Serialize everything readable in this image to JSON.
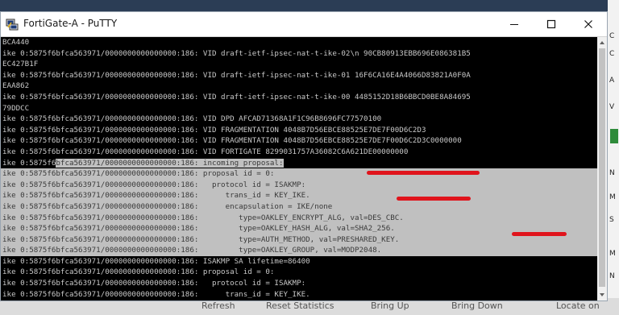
{
  "window": {
    "title": "FortiGate-A - PuTTY"
  },
  "terminal": {
    "lines": [
      "BCA440",
      "ike 0:5875f6bfca563971/0000000000000000:186: VID draft-ietf-ipsec-nat-t-ike-02\\n 90CB80913EBB696E086381B5",
      "EC427B1F",
      "ike 0:5875f6bfca563971/0000000000000000:186: VID draft-ietf-ipsec-nat-t-ike-01 16F6CA16E4A4066D83821A0F0A",
      "EAA862",
      "ike 0:5875f6bfca563971/0000000000000000:186: VID draft-ietf-ipsec-nat-t-ike-00 4485152D18B6BBCD0BE8A84695",
      "79DDCC",
      "ike 0:5875f6bfca563971/0000000000000000:186: VID DPD AFCAD71368A1F1C96B8696FC77570100",
      "ike 0:5875f6bfca563971/0000000000000000:186: VID FRAGMENTATION 4048B7D56EBCE88525E7DE7F00D6C2D3",
      "ike 0:5875f6bfca563971/0000000000000000:186: VID FRAGMENTATION 4048B7D56EBCE88525E7DE7F00D6C2D3C0000000",
      "ike 0:5875f6bfca563971/0000000000000000:186: VID FORTIGATE 8299031757A36082C6A621DE00000000",
      "ike 0:5875f6bfca563971/0000000000000000:186: incoming proposal:",
      "ike 0:5875f6bfca563971/0000000000000000:186: proposal id = 0:",
      "ike 0:5875f6bfca563971/0000000000000000:186:   protocol id = ISAKMP:",
      "ike 0:5875f6bfca563971/0000000000000000:186:      trans_id = KEY_IKE.",
      "ike 0:5875f6bfca563971/0000000000000000:186:      encapsulation = IKE/none",
      "ike 0:5875f6bfca563971/0000000000000000:186:         type=OAKLEY_ENCRYPT_ALG, val=DES_CBC.",
      "ike 0:5875f6bfca563971/0000000000000000:186:         type=OAKLEY_HASH_ALG, val=SHA2_256.",
      "ike 0:5875f6bfca563971/0000000000000000:186:         type=AUTH_METHOD, val=PRESHARED_KEY.",
      "ike 0:5875f6bfca563971/0000000000000000:186:         type=OAKLEY_GROUP, val=MODP2048.",
      "ike 0:5875f6bfca563971/0000000000000000:186: ISAKMP SA lifetime=86400",
      "ike 0:5875f6bfca563971/0000000000000000:186: proposal id = 0:",
      "ike 0:5875f6bfca563971/0000000000000000:186:   protocol id = ISAKMP:",
      "ike 0:5875f6bfca563971/0000000000000000:186:      trans_id = KEY_IKE."
    ],
    "selection": {
      "first_line": 11,
      "last_line": 19,
      "partial_line": 11,
      "partial_prefix": "ike 0:5875f6",
      "partial_rest": "bfca563971/0000000000000000:186: incoming proposal:"
    }
  },
  "taskbar": {
    "items": [
      "Refresh",
      "Reset Statistics",
      "Bring Up",
      "Bring Down",
      "Locate on"
    ]
  },
  "right_panel": {
    "letters": [
      "C",
      "C",
      "A",
      "V",
      "N",
      "M",
      "S",
      "M",
      "N"
    ]
  },
  "colors": {
    "annotation_red": "#e0141c",
    "terminal_bg": "#000000",
    "terminal_fg": "#c8c8c8",
    "selection_bg": "#c0c0c0"
  },
  "icons": {
    "app": "putty-icon",
    "minimize": "minimize-icon",
    "maximize": "maximize-icon",
    "close": "close-icon"
  }
}
